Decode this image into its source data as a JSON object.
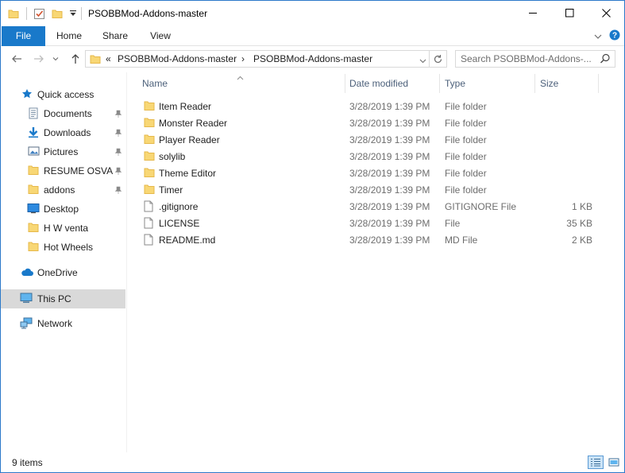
{
  "window": {
    "title": "PSOBBMod-Addons-master",
    "minimize_glyph": "—",
    "maximize_glyph": "☐",
    "close_glyph": "✕"
  },
  "ribbon": {
    "tabs": [
      {
        "label": "File"
      },
      {
        "label": "Home"
      },
      {
        "label": "Share"
      },
      {
        "label": "View"
      }
    ]
  },
  "address": {
    "overflow": "«",
    "segments": [
      "PSOBBMod-Addons-master",
      "PSOBBMod-Addons-master"
    ],
    "separator": "›"
  },
  "search": {
    "placeholder": "Search PSOBBMod-Addons-..."
  },
  "nav": {
    "quick_access": "Quick access",
    "pinned": [
      {
        "label": "Documents",
        "icon": "documents-icon",
        "pinned": true
      },
      {
        "label": "Downloads",
        "icon": "downloads-icon",
        "pinned": true
      },
      {
        "label": "Pictures",
        "icon": "pictures-icon",
        "pinned": true
      },
      {
        "label": "RESUME OSVALD",
        "icon": "folder-icon",
        "pinned": true
      },
      {
        "label": "addons",
        "icon": "folder-icon",
        "pinned": true
      },
      {
        "label": "Desktop",
        "icon": "desktop-icon",
        "pinned": false
      },
      {
        "label": "H W venta",
        "icon": "folder-icon",
        "pinned": false
      },
      {
        "label": "Hot Wheels",
        "icon": "folder-icon",
        "pinned": false
      }
    ],
    "onedrive": "OneDrive",
    "this_pc": "This PC",
    "network": "Network"
  },
  "columns": {
    "name": "Name",
    "date": "Date modified",
    "type": "Type",
    "size": "Size"
  },
  "files": [
    {
      "name": "Item Reader",
      "date": "3/28/2019 1:39 PM",
      "type": "File folder",
      "size": "",
      "icon": "folder-icon"
    },
    {
      "name": "Monster Reader",
      "date": "3/28/2019 1:39 PM",
      "type": "File folder",
      "size": "",
      "icon": "folder-icon"
    },
    {
      "name": "Player Reader",
      "date": "3/28/2019 1:39 PM",
      "type": "File folder",
      "size": "",
      "icon": "folder-icon"
    },
    {
      "name": "solylib",
      "date": "3/28/2019 1:39 PM",
      "type": "File folder",
      "size": "",
      "icon": "folder-icon"
    },
    {
      "name": "Theme Editor",
      "date": "3/28/2019 1:39 PM",
      "type": "File folder",
      "size": "",
      "icon": "folder-icon"
    },
    {
      "name": "Timer",
      "date": "3/28/2019 1:39 PM",
      "type": "File folder",
      "size": "",
      "icon": "folder-icon"
    },
    {
      "name": ".gitignore",
      "date": "3/28/2019 1:39 PM",
      "type": "GITIGNORE File",
      "size": "1 KB",
      "icon": "file-icon"
    },
    {
      "name": "LICENSE",
      "date": "3/28/2019 1:39 PM",
      "type": "File",
      "size": "35 KB",
      "icon": "file-icon"
    },
    {
      "name": "README.md",
      "date": "3/28/2019 1:39 PM",
      "type": "MD File",
      "size": "2 KB",
      "icon": "file-icon"
    }
  ],
  "status": {
    "item_count": "9 items"
  },
  "colors": {
    "accent": "#1979ca",
    "folder": "#f8d775",
    "folder_dark": "#e6b84a",
    "selected": "#d9d9d9"
  }
}
